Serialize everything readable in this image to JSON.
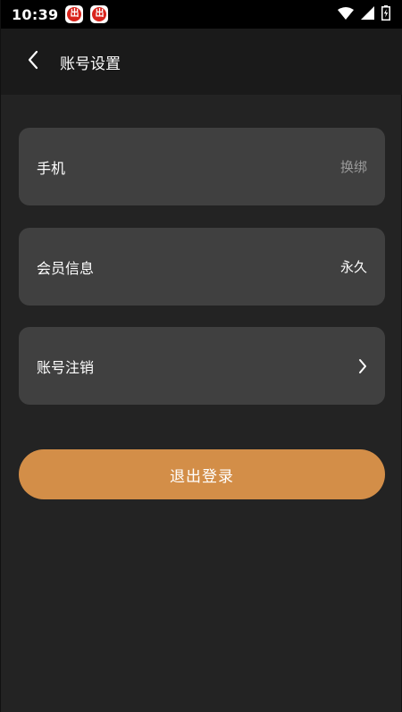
{
  "status_bar": {
    "time": "10:39",
    "notification_icons": [
      "app-notification-icon",
      "app-notification-icon"
    ],
    "system_icons": [
      "wifi-icon",
      "signal-icon",
      "battery-charging-icon"
    ]
  },
  "header": {
    "title": "账号设置",
    "back_icon": "back-chevron-icon"
  },
  "cards": {
    "phone": {
      "label": "手机",
      "value": "换绑"
    },
    "membership": {
      "label": "会员信息",
      "value": "永久"
    },
    "cancel_account": {
      "label": "账号注销",
      "icon": "chevron-right-icon"
    }
  },
  "logout_label": "退出登录",
  "colors": {
    "background": "#232323",
    "header": "#1a1a1a",
    "card": "#404040",
    "accent": "#d38e48",
    "muted_text": "#9a9a9a"
  }
}
